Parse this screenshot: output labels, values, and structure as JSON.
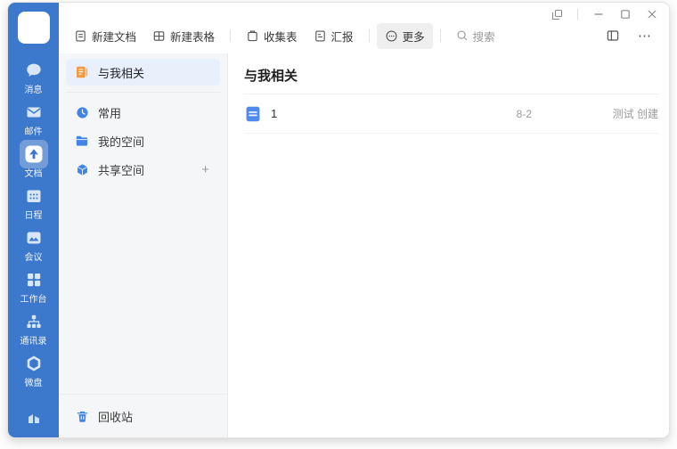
{
  "rail": {
    "items": [
      {
        "id": "messages",
        "label": "消息",
        "icon": "chat-bubble-icon"
      },
      {
        "id": "mail",
        "label": "邮件",
        "icon": "envelope-icon"
      },
      {
        "id": "docs",
        "label": "文档",
        "icon": "doc-arrow-icon",
        "active": true
      },
      {
        "id": "calendar",
        "label": "日程",
        "icon": "calendar-icon"
      },
      {
        "id": "meeting",
        "label": "会议",
        "icon": "meeting-icon"
      },
      {
        "id": "workbench",
        "label": "工作台",
        "icon": "grid-icon"
      },
      {
        "id": "contacts",
        "label": "通讯录",
        "icon": "org-tree-icon"
      },
      {
        "id": "drive",
        "label": "微盘",
        "icon": "drive-icon"
      }
    ]
  },
  "toolbar": {
    "new_doc": "新建文档",
    "new_sheet": "新建表格",
    "collect_form": "收集表",
    "report": "汇报",
    "more": "更多",
    "search_placeholder": "搜索",
    "overflow_glyph": "⋯"
  },
  "sidebar": {
    "items": [
      {
        "label": "与我相关",
        "icon": "orange-doc-icon",
        "active": true
      },
      {
        "label": "常用",
        "icon": "clock-icon"
      },
      {
        "label": "我的空间",
        "icon": "folder-icon"
      },
      {
        "label": "共享空间",
        "icon": "cube-icon",
        "add_glyph": "+"
      }
    ],
    "recycle_bin_label": "回收站"
  },
  "main": {
    "title": "与我相关",
    "files": [
      {
        "name": "1",
        "date": "8-2",
        "creator": "测试 创建"
      }
    ]
  },
  "icons": {
    "window": [
      "popout-icon",
      "minimize-icon",
      "maximize-icon",
      "close-icon"
    ],
    "toolbar": [
      "new-doc-icon",
      "new-sheet-icon",
      "collect-form-icon",
      "report-icon",
      "more-circle-icon",
      "search-icon",
      "panel-toggle-icon",
      "overflow-menu-icon"
    ]
  },
  "colors": {
    "rail_blue": "#3c78cb",
    "accent_blue": "#4285e8",
    "selected_item_bg": "#e8f1fb",
    "orange": "#f79a3e",
    "meta_gray": "#9b9b9b"
  }
}
